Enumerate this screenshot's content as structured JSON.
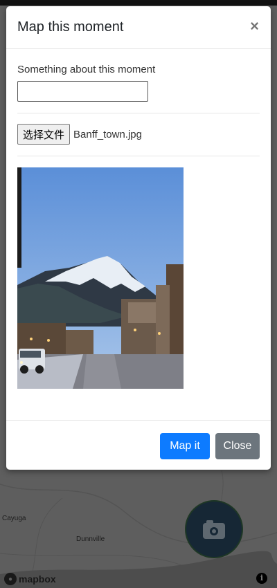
{
  "modal": {
    "title": "Map this moment",
    "close_symbol": "×",
    "description_label": "Something about this moment",
    "description_value": "",
    "file_button_label": "选择文件",
    "file_name": "Banff_town.jpg",
    "photo_icon": "photo-preview",
    "primary_button": "Map it",
    "secondary_button": "Close",
    "primary_color": "#0d7bff",
    "secondary_color": "#6c757d"
  },
  "map": {
    "labels": [
      "Cayuga",
      "Dunnville"
    ],
    "attribution": "mapbox",
    "info_symbol": "i",
    "fab_icon": "camera-icon"
  }
}
